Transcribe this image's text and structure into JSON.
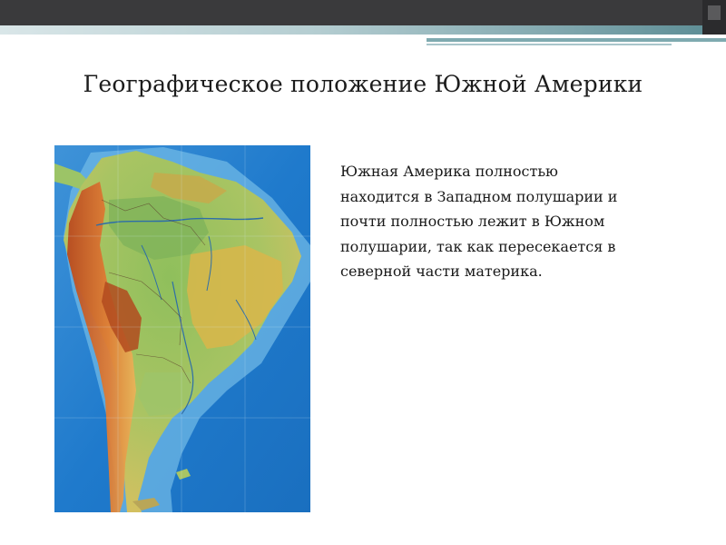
{
  "slide": {
    "title": "Географическое положение Южной Америки",
    "body_lines": [
      "Южная Америка полностью",
      "находится в Западном полушарии и",
      "почти полностью лежит в Южном",
      "полушарии, так как пересекается в",
      "северной части материка."
    ],
    "map_image": "physical-map-south-america"
  },
  "colors": {
    "header_band": "#3a3a3c",
    "header_accent": "#7aa1a8",
    "ocean": "#1d77c9",
    "shelf": "#6fb8e6",
    "lowland": "#7fb35a",
    "highland": "#d9b64a",
    "mountains": "#c9652a",
    "text": "#1a1a1a"
  }
}
